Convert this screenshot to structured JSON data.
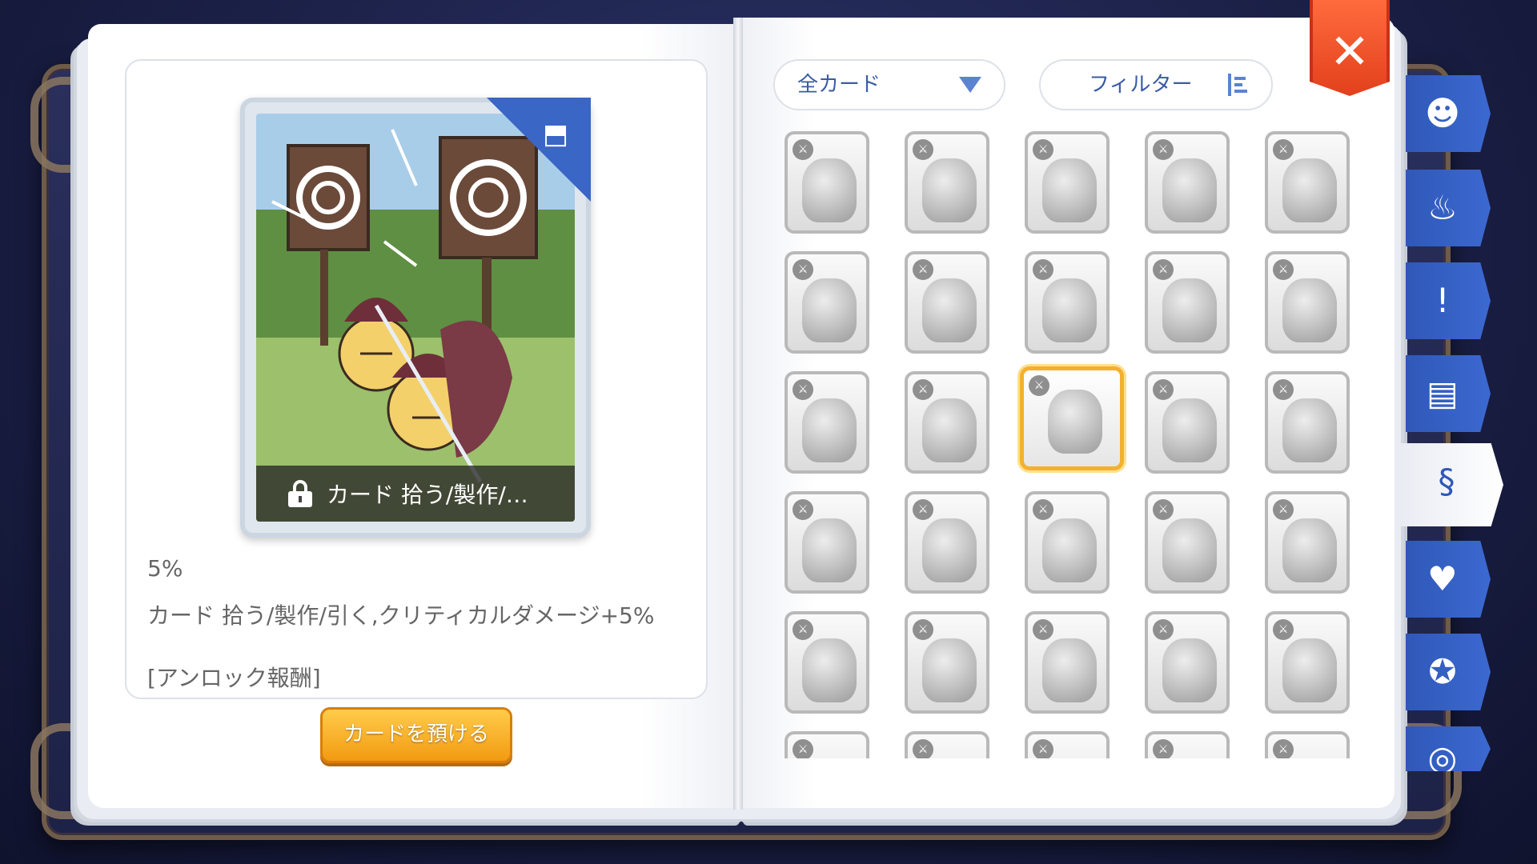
{
  "card_detail": {
    "caption": "カード  拾う/製作/…",
    "rate": "5%",
    "effect": "カード  拾う/製作/引く,クリティカルダメージ+5%",
    "reward_label": "[アンロック報酬]",
    "deposit_button": "カードを預ける"
  },
  "toolbar": {
    "dropdown_value": "全カード",
    "filter_label": "フィルター",
    "close_label": "✕"
  },
  "card_grid": {
    "selected_index": 12,
    "rows": 6,
    "columns": 5
  },
  "side_tabs": [
    {
      "icon": "monster-face-icon",
      "glyph": "☻"
    },
    {
      "icon": "chef-hat-icon",
      "glyph": "♨"
    },
    {
      "icon": "npc-alert-icon",
      "glyph": "!"
    },
    {
      "icon": "open-book-icon",
      "glyph": "▤"
    },
    {
      "icon": "card-icon",
      "glyph": "§",
      "active": true
    },
    {
      "icon": "toolbox-heart-icon",
      "glyph": "♥"
    },
    {
      "icon": "medal-icon",
      "glyph": "✪"
    },
    {
      "icon": "radar-icon",
      "glyph": "◎"
    }
  ],
  "colors": {
    "accent_blue": "#2f58b8",
    "close_red": "#e2401c",
    "deposit_orange": "#f39a12",
    "selected_border": "#f4b02e"
  }
}
